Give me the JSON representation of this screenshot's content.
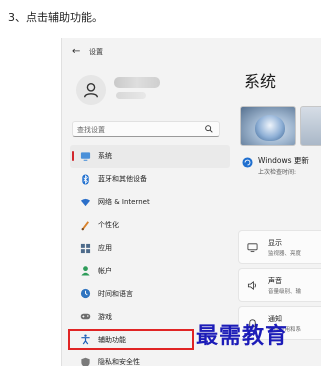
{
  "step_instruction": "3、点击辅助功能。",
  "window": {
    "back_icon": "back-arrow-icon",
    "title": "设置"
  },
  "user": {
    "avatar_icon": "person-icon"
  },
  "search": {
    "placeholder": "查找设置",
    "icon": "search-icon"
  },
  "nav": {
    "items": [
      {
        "label": "系统",
        "icon": "monitor-icon",
        "selected": true
      },
      {
        "label": "蓝牙和其他设备",
        "icon": "bluetooth-icon"
      },
      {
        "label": "网络 & Internet",
        "icon": "wifi-icon"
      },
      {
        "label": "个性化",
        "icon": "brush-icon"
      },
      {
        "label": "应用",
        "icon": "apps-icon"
      },
      {
        "label": "帐户",
        "icon": "account-icon"
      },
      {
        "label": "时间和语言",
        "icon": "globe-clock-icon"
      },
      {
        "label": "游戏",
        "icon": "gamepad-icon"
      },
      {
        "label": "辅助功能",
        "icon": "accessibility-icon",
        "highlighted": true
      },
      {
        "label": "隐私和安全性",
        "icon": "shield-icon"
      }
    ]
  },
  "main": {
    "title": "系统",
    "windows_update": {
      "title": "Windows 更新",
      "subtitle": "上次检查时间:"
    },
    "cards": [
      {
        "title": "显示",
        "subtitle": "监视器、亮度",
        "icon": "display-icon"
      },
      {
        "title": "声音",
        "subtitle": "音量级别、输",
        "icon": "speaker-icon"
      },
      {
        "title": "通知",
        "subtitle": "来自应用和系",
        "icon": "bell-icon"
      }
    ]
  },
  "watermark": "最需教育",
  "colors": {
    "highlight_box": "#e02424",
    "selected_indicator": "#d1262c",
    "watermark": "#1c1cb8",
    "window_bg": "#f3f3f3"
  }
}
